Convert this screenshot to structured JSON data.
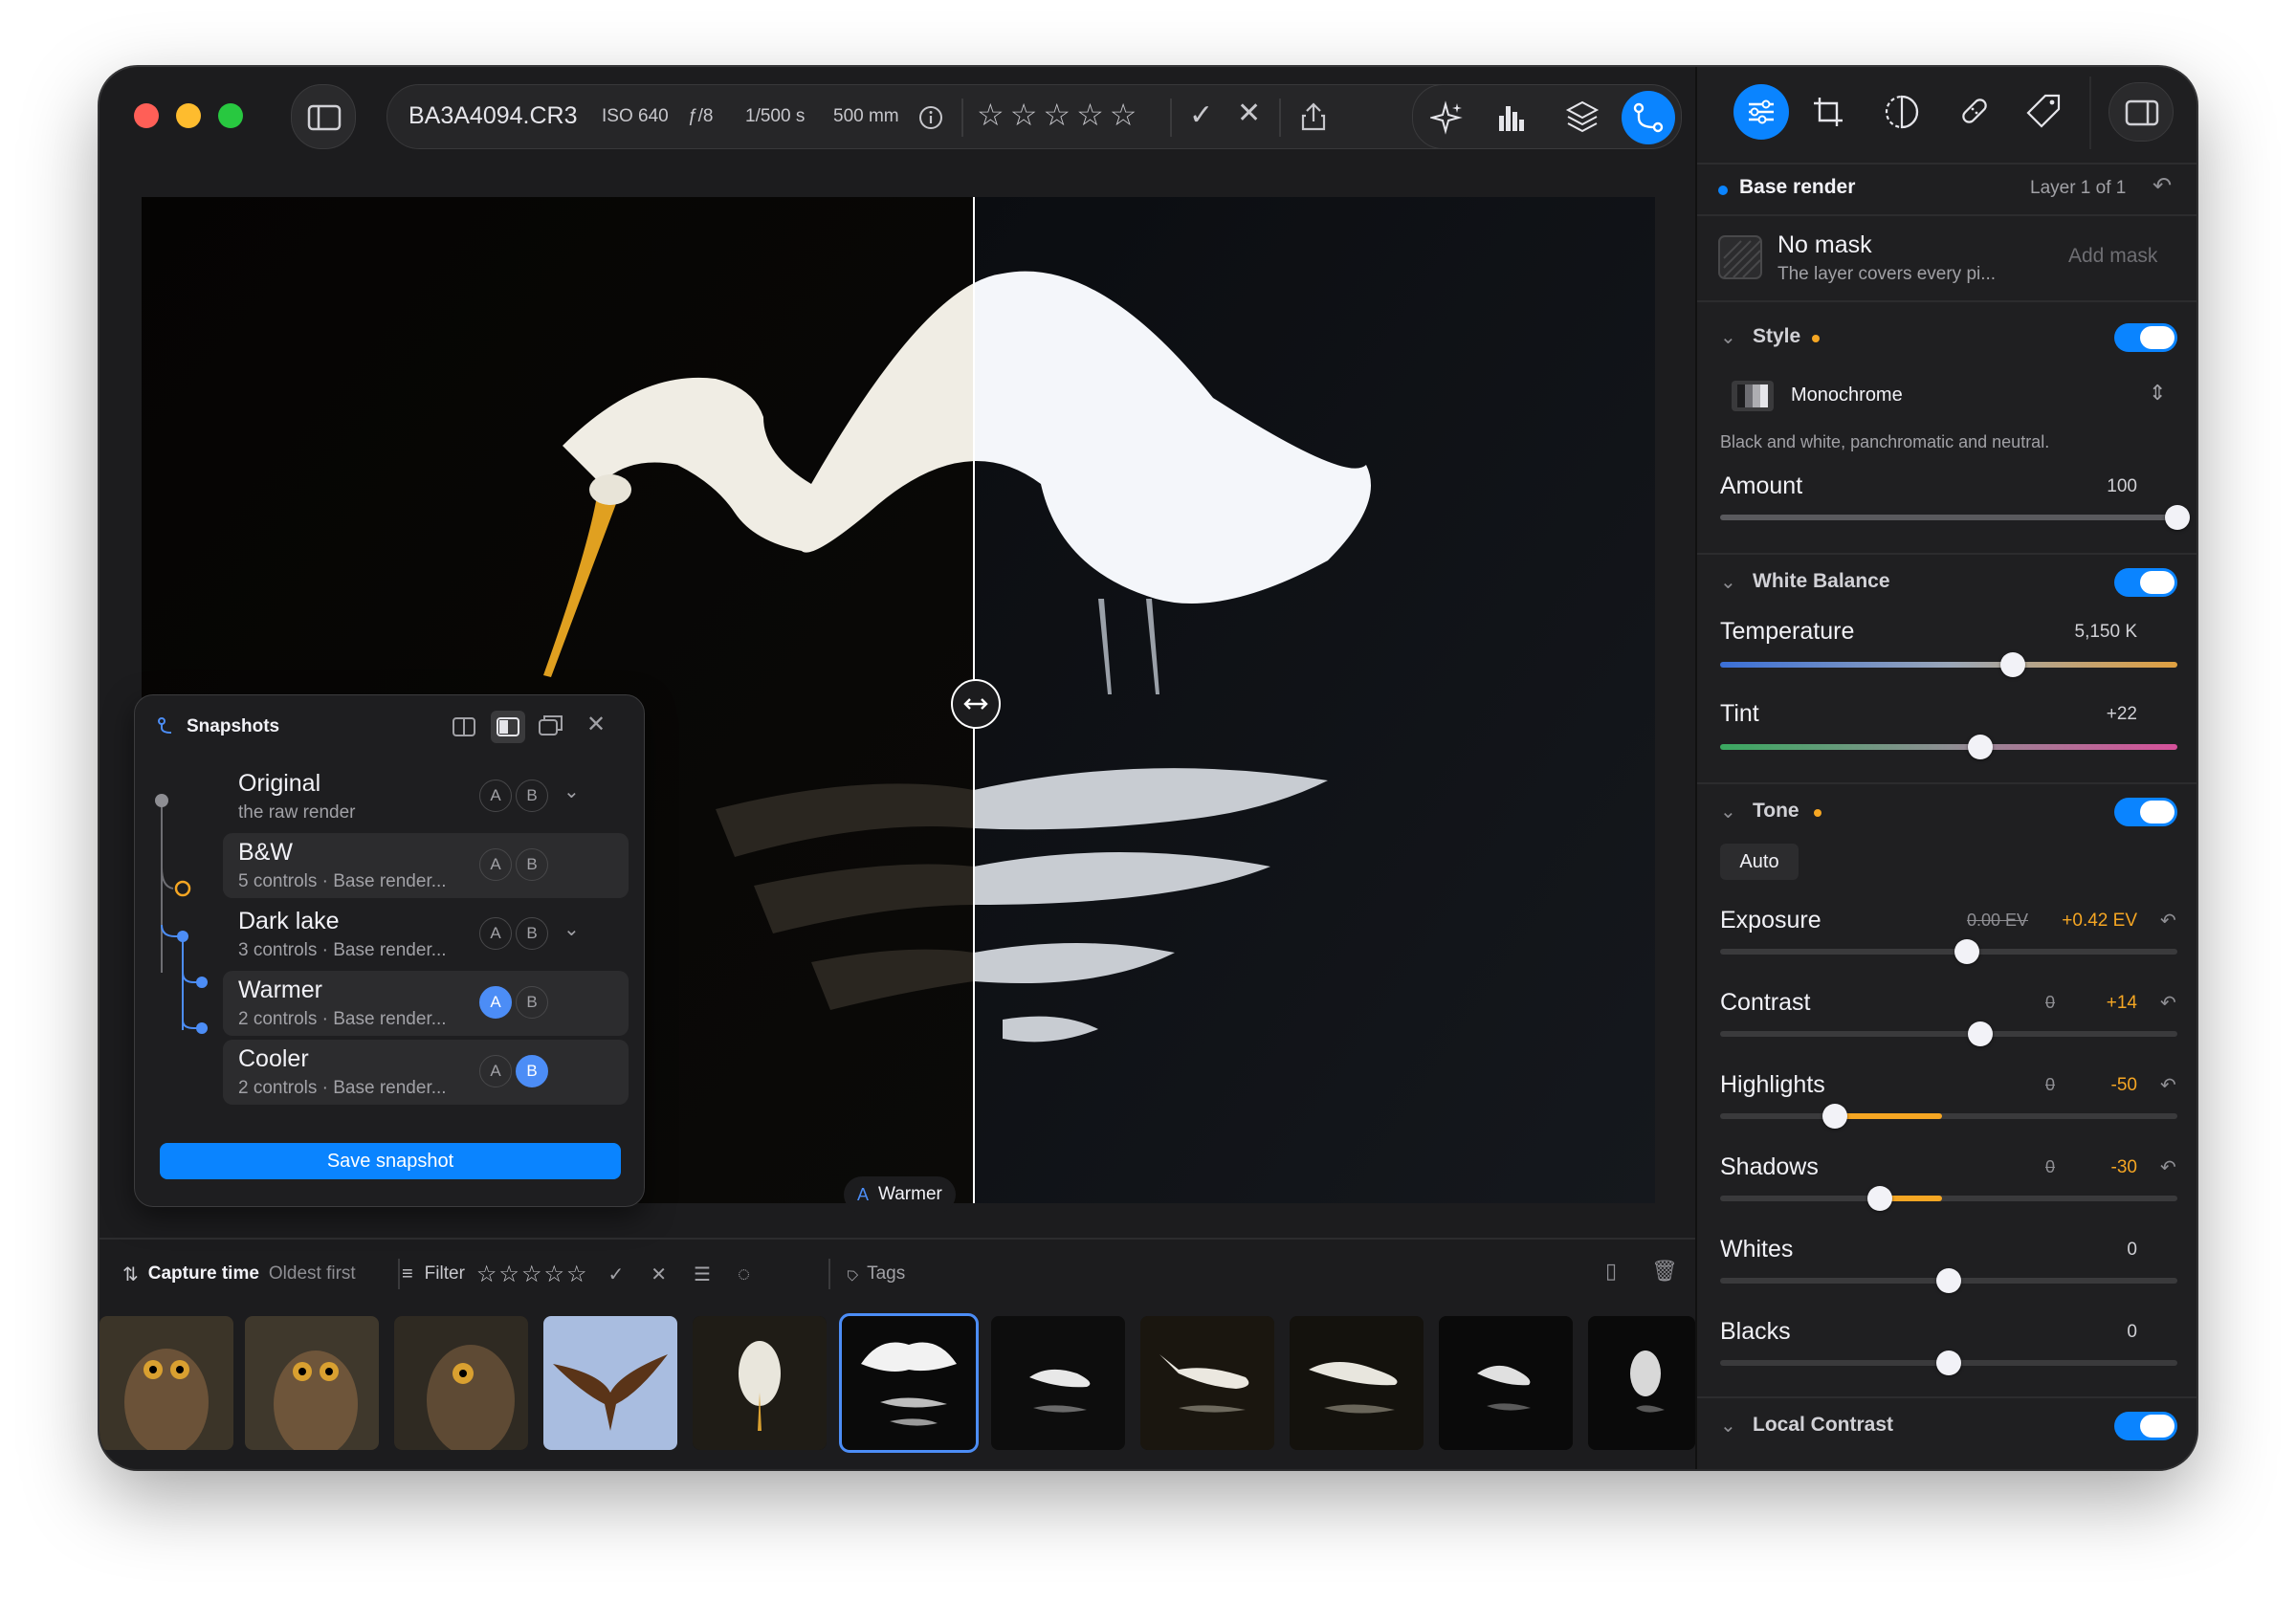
{
  "toolbar": {
    "filename": "BA3A4094.CR3",
    "iso": "ISO 640",
    "aperture": "ƒ/8",
    "shutter": "1/500 s",
    "focal": "500 mm"
  },
  "canvas": {
    "compare_label": "Warmer",
    "compare_badge": "A",
    "split_position_fraction": 0.53
  },
  "snapshots": {
    "title": "Snapshots",
    "items": [
      {
        "title": "Original",
        "subtitle": "the raw render",
        "a": "A",
        "b": "B"
      },
      {
        "title": "B&W",
        "subtitle": "5 controls · Base render...",
        "a": "A",
        "b": "B"
      },
      {
        "title": "Dark lake",
        "subtitle": "3 controls · Base render...",
        "a": "A",
        "b": "B"
      },
      {
        "title": "Warmer",
        "subtitle": "2 controls · Base render...",
        "a": "A",
        "b": "B"
      },
      {
        "title": "Cooler",
        "subtitle": "2 controls · Base render...",
        "a": "A",
        "b": "B"
      }
    ],
    "save_label": "Save snapshot"
  },
  "filter_bar": {
    "sort_label": "Capture time",
    "sort_order": "Oldest first",
    "filter_label": "Filter",
    "tags_label": "Tags"
  },
  "panel": {
    "layer_name": "Base render",
    "layer_count": "Layer 1 of 1",
    "mask_title": "No mask",
    "mask_desc": "The layer covers every pi...",
    "add_mask": "Add mask",
    "style": {
      "header": "Style",
      "preset": "Monochrome",
      "desc": "Black and white, panchromatic and neutral.",
      "amount_label": "Amount",
      "amount_value": "100",
      "amount_fraction": 1.0
    },
    "white_balance": {
      "header": "White Balance",
      "temp_label": "Temperature",
      "temp_value": "5,150 K",
      "temp_fraction": 0.64,
      "tint_label": "Tint",
      "tint_value": "+22",
      "tint_fraction": 0.57
    },
    "tone": {
      "header": "Tone",
      "auto_label": "Auto",
      "exposure_label": "Exposure",
      "exposure_auto": "0.00 EV",
      "exposure_value": "+0.42 EV",
      "exposure_fraction": 0.54,
      "contrast_label": "Contrast",
      "contrast_auto": "0",
      "contrast_value": "+14",
      "contrast_fraction": 0.57,
      "highlights_label": "Highlights",
      "highlights_auto": "0",
      "highlights_value": "-50",
      "highlights_fraction": 0.25,
      "shadows_label": "Shadows",
      "shadows_auto": "0",
      "shadows_value": "-30",
      "shadows_fraction": 0.35,
      "whites_label": "Whites",
      "whites_value": "0",
      "whites_fraction": 0.5,
      "blacks_label": "Blacks",
      "blacks_value": "0",
      "blacks_fraction": 0.5
    },
    "local_contrast_header": "Local Contrast"
  },
  "colors": {
    "accent": "#0a84ff",
    "highlight": "#f5a623",
    "window_bg": "#1c1c1e"
  }
}
